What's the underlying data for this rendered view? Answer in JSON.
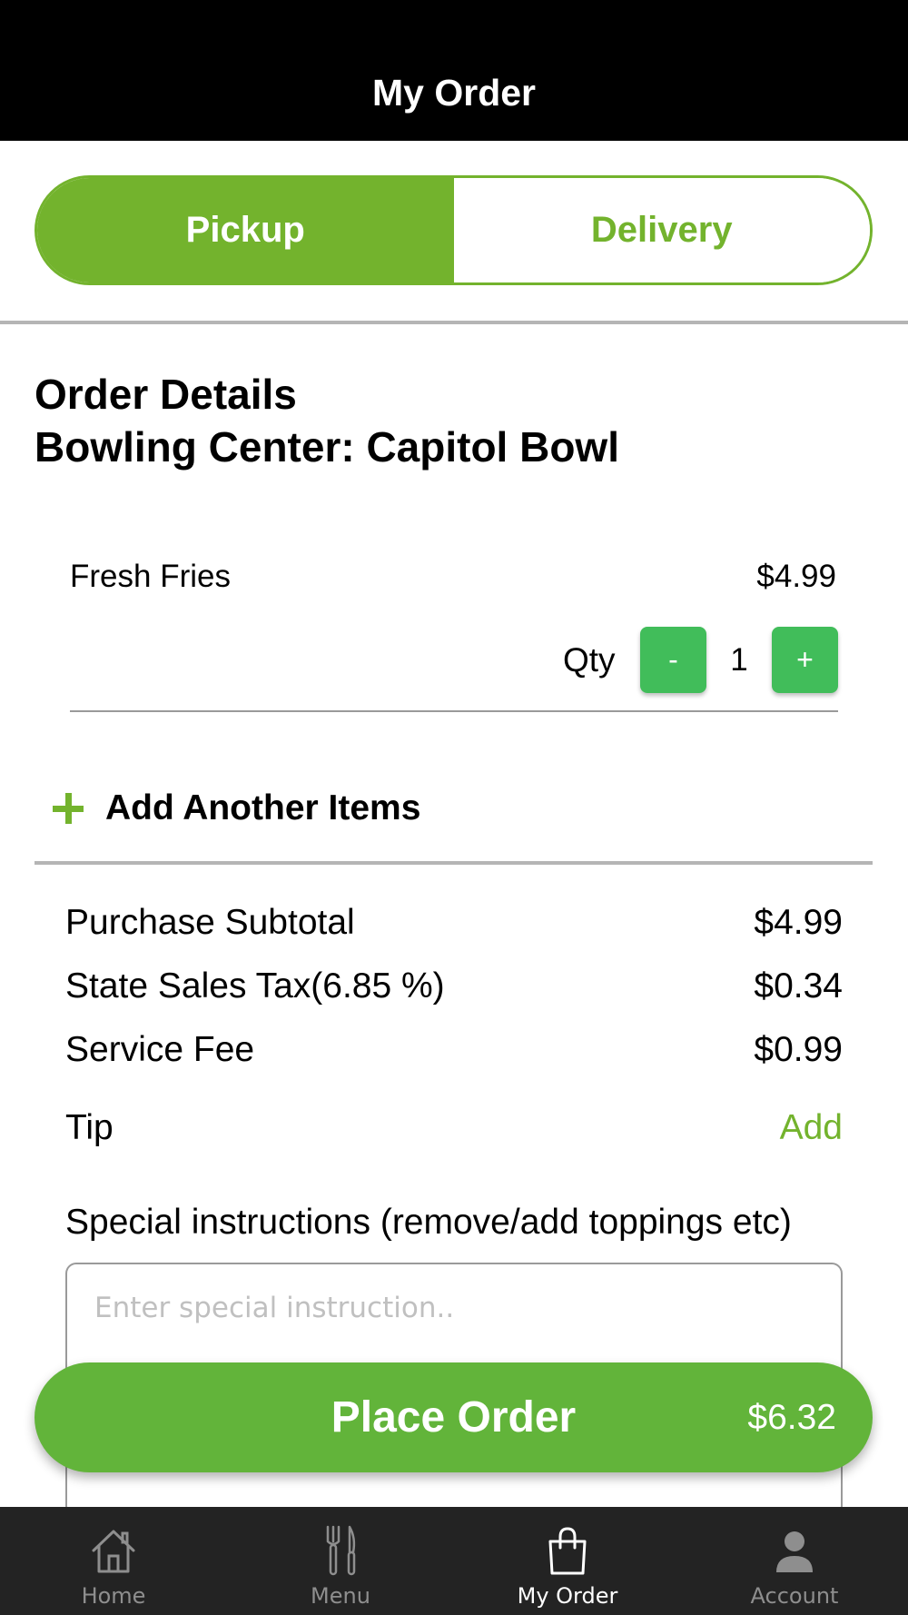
{
  "header": {
    "title": "My Order"
  },
  "order_type": {
    "pickup_label": "Pickup",
    "delivery_label": "Delivery",
    "selected": "Pickup"
  },
  "details": {
    "title_line1": "Order Details",
    "title_line2": "Bowling Center: Capitol Bowl"
  },
  "item": {
    "name": "Fresh Fries",
    "price": "$4.99",
    "qty_label": "Qty",
    "minus": "-",
    "qty": "1",
    "plus": "+"
  },
  "add_items": {
    "label": "Add Another Items"
  },
  "summary": {
    "subtotal_label": "Purchase Subtotal",
    "subtotal_value": "$4.99",
    "tax_label": "State Sales Tax(6.85 %)",
    "tax_value": "$0.34",
    "fee_label": "Service Fee",
    "fee_value": "$0.99",
    "tip_label": "Tip",
    "tip_action": "Add"
  },
  "instructions": {
    "label": "Special instructions (remove/add toppings etc)",
    "placeholder": "Enter special instruction..",
    "value": ""
  },
  "place_order": {
    "label": "Place Order",
    "total": "$6.32"
  },
  "tabbar": {
    "items": [
      {
        "label": "Home",
        "icon": "home-icon"
      },
      {
        "label": "Menu",
        "icon": "fork-knife-icon"
      },
      {
        "label": "My Order",
        "icon": "shopping-bag-icon",
        "active": true
      },
      {
        "label": "Account",
        "icon": "person-icon"
      }
    ]
  },
  "colors": {
    "accent": "#73b32d",
    "qty_button": "#41bd5a",
    "top_bar": "#000000",
    "tab_bar": "#232323"
  }
}
